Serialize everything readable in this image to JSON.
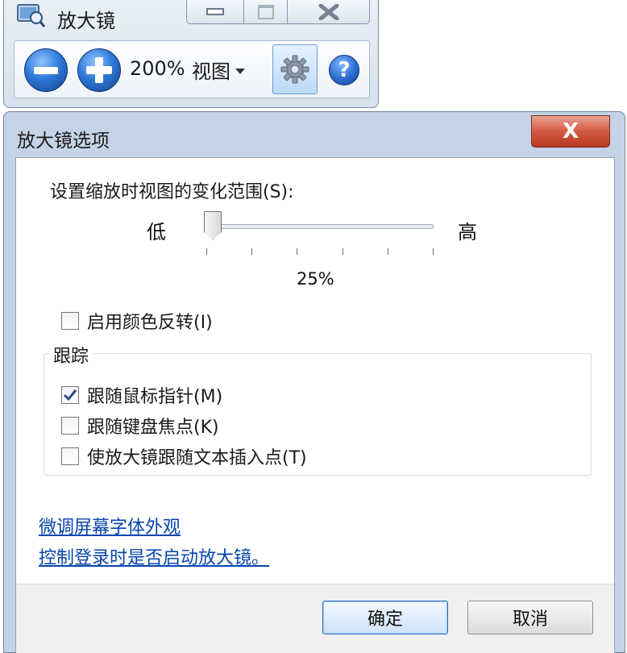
{
  "magnifier": {
    "title": "放大镜",
    "zoom_level": "200%",
    "view_menu_label": "视图",
    "icons": [
      "magnifier-app-icon",
      "zoom-out-icon",
      "zoom-in-icon",
      "chevron-down-icon",
      "gear-icon",
      "help-icon"
    ]
  },
  "dialog": {
    "title": "放大镜选项",
    "close_glyph": "X",
    "range_label": "设置缩放时视图的变化范围(S):",
    "slider": {
      "low_label": "低",
      "high_label": "高",
      "value_text": "25%",
      "value_fraction": 0.0,
      "tick_count": 6
    },
    "invert_color": {
      "label": "启用颜色反转(I)",
      "checked": false
    },
    "tracking": {
      "group_title": "跟踪",
      "options": [
        {
          "label": "跟随鼠标指针(M)",
          "checked": true
        },
        {
          "label": "跟随键盘焦点(K)",
          "checked": false
        },
        {
          "label": "使放大镜跟随文本插入点(T)",
          "checked": false
        }
      ]
    },
    "links": [
      {
        "text": "微调屏幕字体外观"
      },
      {
        "text": "控制登录时是否启动放大镜。"
      }
    ],
    "buttons": {
      "ok": "确定",
      "cancel": "取消"
    }
  },
  "colors": {
    "accent": "#2f79d8",
    "link": "#0645ad",
    "close": "#d45a42"
  }
}
